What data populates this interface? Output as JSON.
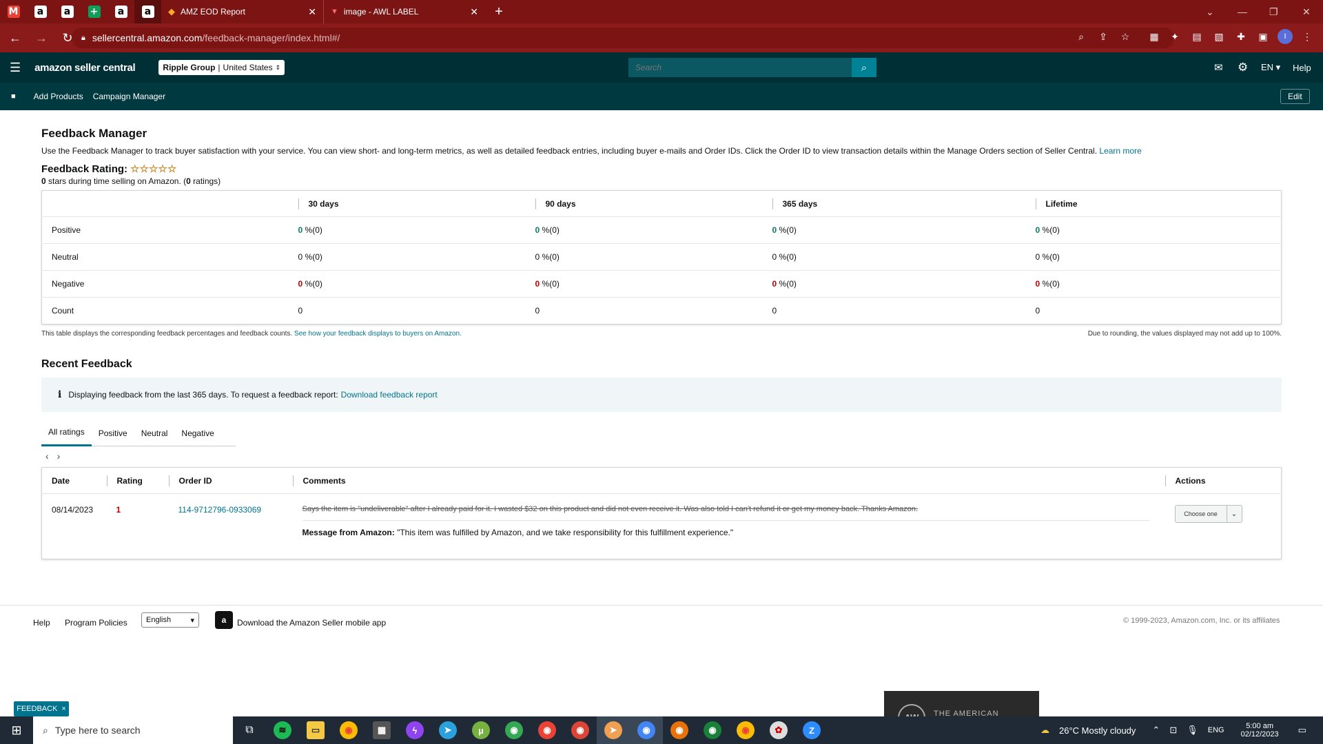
{
  "browser": {
    "pinned_tabs": [
      {
        "icon": "gmail-icon",
        "glyph": "M",
        "color": "#ea4335"
      },
      {
        "icon": "amazon-icon",
        "glyph": "a",
        "color": "#fff"
      },
      {
        "icon": "amazon-icon",
        "glyph": "a",
        "color": "#fff"
      },
      {
        "icon": "sheets-icon",
        "glyph": "+",
        "color": "#0f9d58"
      },
      {
        "icon": "amazon-icon",
        "glyph": "a",
        "color": "#fff"
      },
      {
        "icon": "amazon-icon",
        "glyph": "a",
        "color": "#fff"
      }
    ],
    "tabs": [
      {
        "title": "AMZ EOD Report",
        "icon": "clickup-icon"
      },
      {
        "title": "image - AWL LABEL",
        "icon": "label-icon"
      }
    ],
    "url_host": "sellercentral.amazon.com",
    "url_path": "/feedback-manager/index.html#/"
  },
  "header": {
    "logo": "amazon seller central",
    "account": "Ripple Group",
    "marketplace": "United States",
    "search_placeholder": "Search",
    "language": "EN",
    "help": "Help"
  },
  "subnav": {
    "items": [
      "Add Products",
      "Campaign Manager"
    ],
    "edit": "Edit"
  },
  "page": {
    "title": "Feedback Manager",
    "description": "Use the Feedback Manager to track buyer satisfaction with your service. You can view short- and long-term metrics, as well as detailed feedback entries, including buyer e-mails and Order IDs. Click the Order ID to view transaction details within the Manage Orders section of Seller Central.",
    "learn_more": "Learn more",
    "rating_label": "Feedback Rating:",
    "rating_stars": 0,
    "rating_count_stars": "0",
    "rating_sub_mid": " stars during time selling on Amazon. (",
    "rating_count": "0",
    "rating_sub_end": " ratings)"
  },
  "metrics": {
    "columns": [
      "30 days",
      "90 days",
      "365 days",
      "Lifetime"
    ],
    "rows": [
      {
        "label": "Positive",
        "cells": [
          [
            "0",
            " %(0)"
          ],
          [
            "0",
            " %(0)"
          ],
          [
            "0",
            " %(0)"
          ],
          [
            "0",
            " %(0)"
          ]
        ],
        "tone": "g"
      },
      {
        "label": "Neutral",
        "cells": [
          [
            "0",
            " %(0)"
          ],
          [
            "0",
            " %(0)"
          ],
          [
            "0",
            " %(0)"
          ],
          [
            "0",
            " %(0)"
          ]
        ],
        "tone": ""
      },
      {
        "label": "Negative",
        "cells": [
          [
            "0",
            " %(0)"
          ],
          [
            "0",
            " %(0)"
          ],
          [
            "0",
            " %(0)"
          ],
          [
            "0",
            " %(0)"
          ]
        ],
        "tone": "r"
      },
      {
        "label": "Count",
        "cells": [
          [
            "",
            "0"
          ],
          [
            "",
            "0"
          ],
          [
            "",
            "0"
          ],
          [
            "",
            "0"
          ]
        ],
        "tone": ""
      }
    ],
    "note_left": "This table displays the corresponding feedback percentages and feedback counts.",
    "note_link": "See how your feedback displays to buyers on Amazon.",
    "note_right": "Due to rounding, the values displayed may not add up to 100%."
  },
  "recent": {
    "title": "Recent Feedback",
    "info": "Displaying feedback from the last 365 days. To request a feedback report:",
    "info_link": "Download feedback report",
    "tabs": [
      "All ratings",
      "Positive",
      "Neutral",
      "Negative"
    ],
    "columns": [
      "Date",
      "Rating",
      "Order ID",
      "Comments",
      "Actions"
    ],
    "rows": [
      {
        "date": "08/14/2023",
        "rating": "1",
        "order_id": "114-9712796-0933069",
        "comment": "Says the item is \"undeliverable\" after I already paid for it. I wasted $32 on this product and did not even receive it. Was also told I can't refund it or get my money back. Thanks Amazon.",
        "msg_label": "Message from Amazon:",
        "msg_text": " \"This item was fulfilled by Amazon, and we take responsibility for this fulfillment experience.\"",
        "action": "Choose one"
      }
    ]
  },
  "footer": {
    "help": "Help",
    "policies": "Program Policies",
    "language": "English",
    "app": "Download the Amazon Seller mobile app",
    "copyright": "© 1999-2023, Amazon.com, Inc. or its affiliates",
    "feedback_tag": "FEEDBACK"
  },
  "taskbar": {
    "search": "Type here to search",
    "promo": "THE AMERICAN WHOLESALERS",
    "weather": "26°C  Mostly cloudy",
    "lang": "ENG",
    "time": "5:00 am",
    "date": "02/12/2023"
  }
}
